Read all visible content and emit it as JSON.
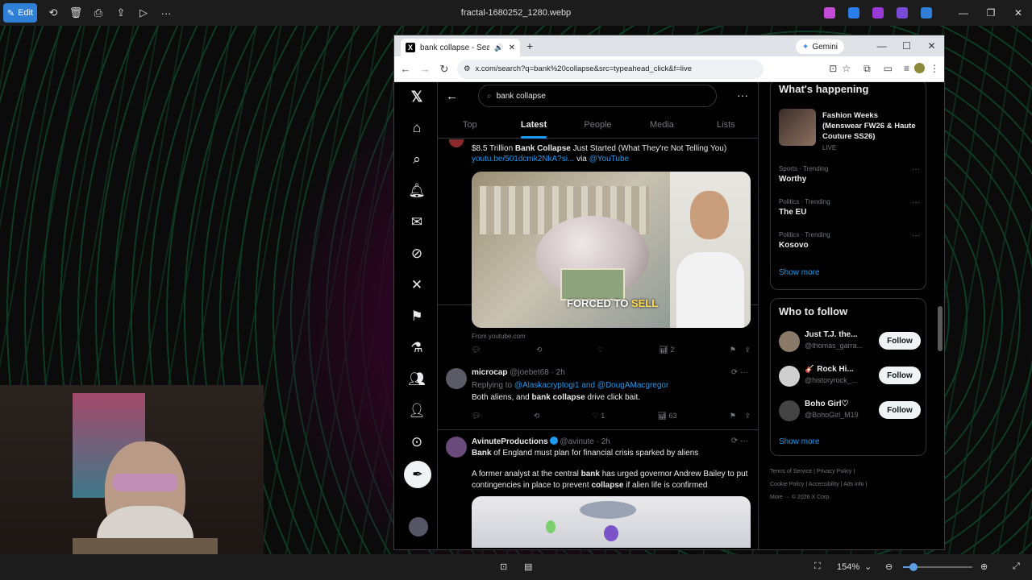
{
  "viewer": {
    "title": "fractal-1680252_1280.webp",
    "edit_label": "Edit",
    "zoom": "154%",
    "zoom_level_fraction": 0.15
  },
  "browser": {
    "tab_title": "bank collapse - Search / X",
    "gemini_label": "Gemini",
    "url": "x.com/search?q=bank%20collapse&src=typeahead_click&f=live"
  },
  "x": {
    "search_value": "bank collapse",
    "tabs": [
      "Top",
      "Latest",
      "People",
      "Media",
      "Lists"
    ],
    "active_tab": "Latest",
    "tweet1": {
      "line1_pre": "$8.5 Trillion ",
      "line1_bold": "Bank Collapse",
      "line1_post": " Just Started (What They're Not Telling You)",
      "link": "youtu.be/501dcmk2NkA?si...",
      "via": " via ",
      "via_handle": "@YouTube",
      "caption_pre": "FORCED TO ",
      "caption_hl": "SELL",
      "from": "From youtube.com",
      "views": "2"
    },
    "tweet2": {
      "name": "microcap",
      "meta": "@joebet68 · 2h",
      "replying": "Replying to ",
      "replying_to": "@Alaskacryptogi1 and @DougAMacgregor",
      "text_pre": "Both aliens, and ",
      "text_bold": "bank collapse",
      "text_post": " drive click bait.",
      "likes": "1",
      "views": "63"
    },
    "tweet3": {
      "name": "AvinuteProductions",
      "meta": "@avinute · 2h",
      "line1_bold": "Bank",
      "line1_post": " of England must plan for financial crisis sparked by aliens",
      "p2_pre": "A former analyst at the central ",
      "p2_bold": "bank",
      "p2_mid": " has urged governor Andrew Bailey to put contingencies in place to prevent ",
      "p2_bold2": "collapse",
      "p2_post": " if alien life is confirmed"
    },
    "happening": {
      "title": "What's happening",
      "featured_title": "Fashion Weeks (Menswear FW26 & Haute Couture SS26)",
      "featured_meta": "LIVE",
      "trends": [
        {
          "meta": "Sports · Trending",
          "name": "Worthy"
        },
        {
          "meta": "Politics · Trending",
          "name": "The EU"
        },
        {
          "meta": "Politics · Trending",
          "name": "Kosovo"
        }
      ],
      "show_more": "Show more"
    },
    "who_to_follow": {
      "title": "Who to follow",
      "users": [
        {
          "name": "Just T.J. the...",
          "handle": "@thomas_garra..."
        },
        {
          "name": "🎸 Rock Hi...",
          "handle": "@historyrock_..."
        },
        {
          "name": "Boho Girl♡",
          "handle": "@BohoGirl_M19"
        }
      ],
      "follow_label": "Follow",
      "show_more": "Show more"
    },
    "footer": {
      "line1": "Terms of Service  |  Privacy Policy  |",
      "line2": "Cookie Policy  |  Accessibility  |  Ads info  |",
      "line3": "More ···  © 2026 X Corp."
    }
  },
  "colors": {
    "accent": "#1d9bf0",
    "edit": "#2f7fd6"
  }
}
